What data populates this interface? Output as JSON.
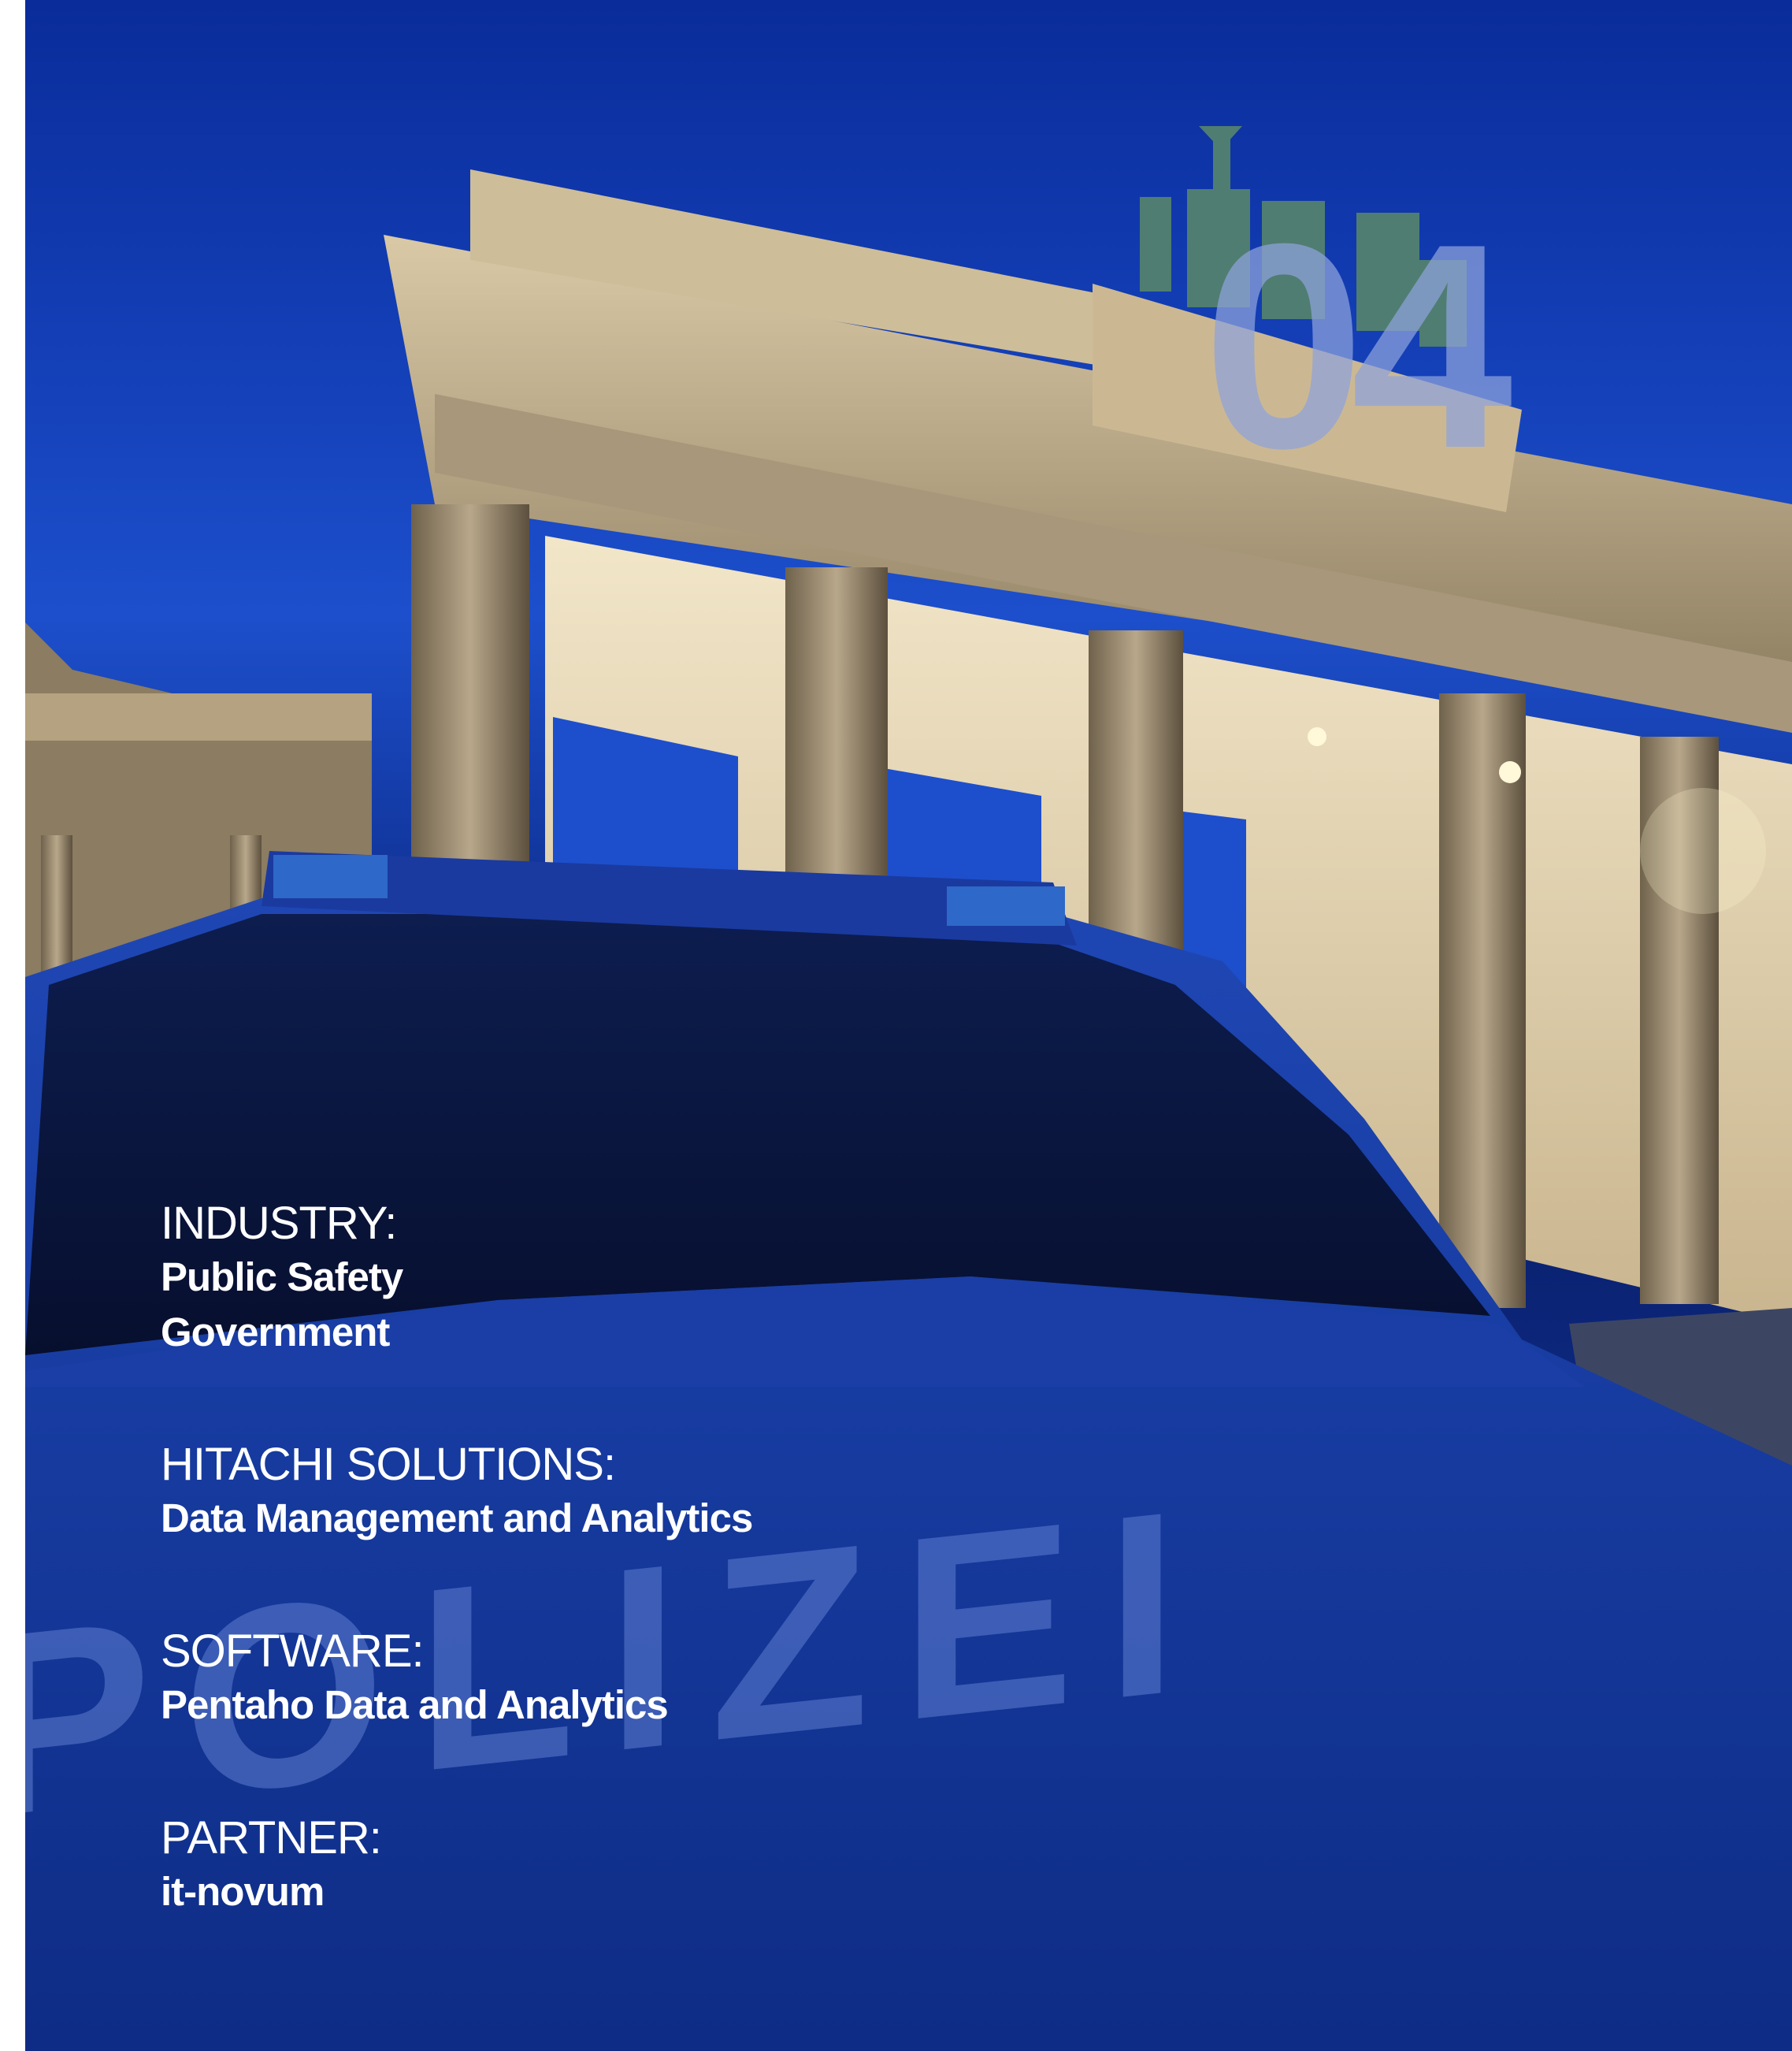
{
  "page_number": "04",
  "vehicle_lettering": "POLIZEI",
  "colors": {
    "background_blue": "#0b2373",
    "sky_blue": "#1d4fcc",
    "text": "#ffffff",
    "page_number": "#8fa3dc"
  },
  "blocks": [
    {
      "label": "INDUSTRY:",
      "values": [
        "Public Safety",
        "Government"
      ]
    },
    {
      "label": "HITACHI SOLUTIONS:",
      "values": [
        "Data Management and Analytics"
      ]
    },
    {
      "label": "SOFTWARE:",
      "values": [
        "Pentaho Data and Analytics"
      ]
    },
    {
      "label": "PARTNER:",
      "values": [
        "it-novum"
      ]
    }
  ]
}
